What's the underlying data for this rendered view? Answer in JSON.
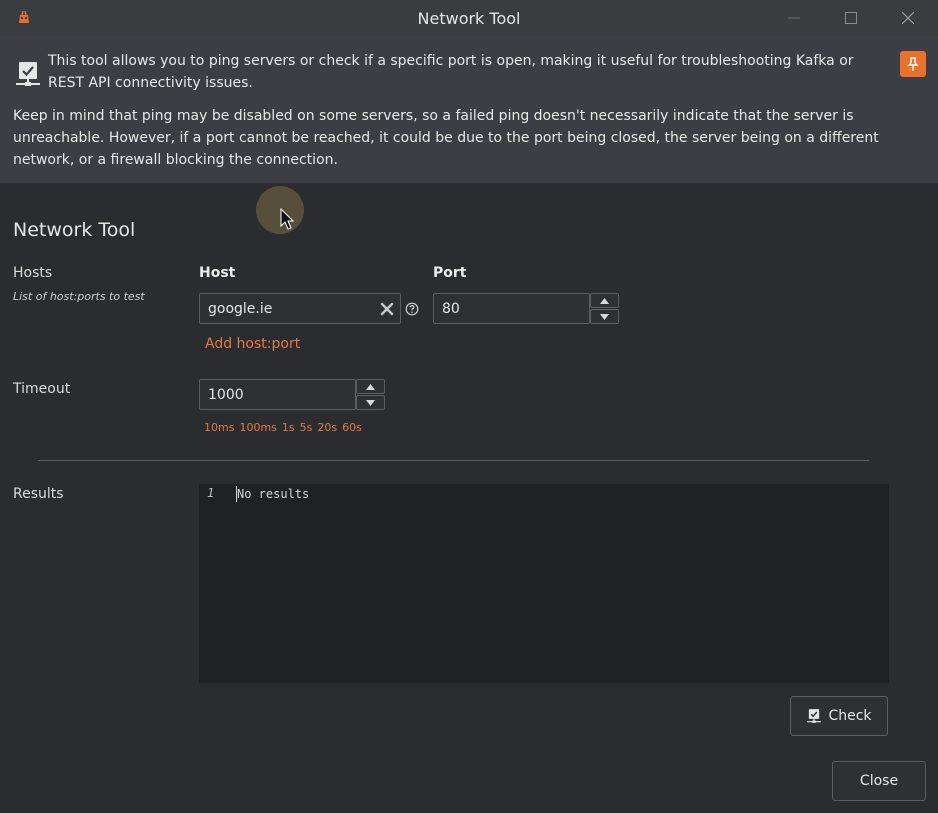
{
  "window": {
    "title": "Network Tool",
    "minimize_icon": "minimize-icon",
    "maximize_icon": "maximize-icon",
    "close_icon": "close-icon"
  },
  "info": {
    "icon": "network-check-icon",
    "line1": "This tool allows you to ping servers or check if a specific port is open, making it useful for troubleshooting Kafka or REST API connectivity issues.",
    "line2": "Keep in mind that ping may be disabled on some servers, so a failed ping doesn't necessarily indicate that the server is unreachable. However, if a port cannot be reached, it could be due to the port being closed, the server being on a different network, or a firewall blocking the connection.",
    "pin_icon": "pin-icon"
  },
  "form": {
    "heading": "Network Tool",
    "hosts_label": "Hosts",
    "hosts_sublabel": "List of host:ports to test",
    "host_col": "Host",
    "port_col": "Port",
    "host_value": "google.ie",
    "port_value": "80",
    "add_link": "Add host:port",
    "timeout_label": "Timeout",
    "timeout_value": "1000",
    "timeout_presets": [
      "10ms",
      "100ms",
      "1s",
      "5s",
      "20s",
      "60s"
    ],
    "results_label": "Results",
    "results_line_number": "1",
    "results_text": "No results"
  },
  "buttons": {
    "check": "Check",
    "close": "Close"
  },
  "colors": {
    "accent": "#e8712c",
    "link": "#e27a3f",
    "background": "#2b2c2f",
    "info_band": "#3c3e43"
  }
}
